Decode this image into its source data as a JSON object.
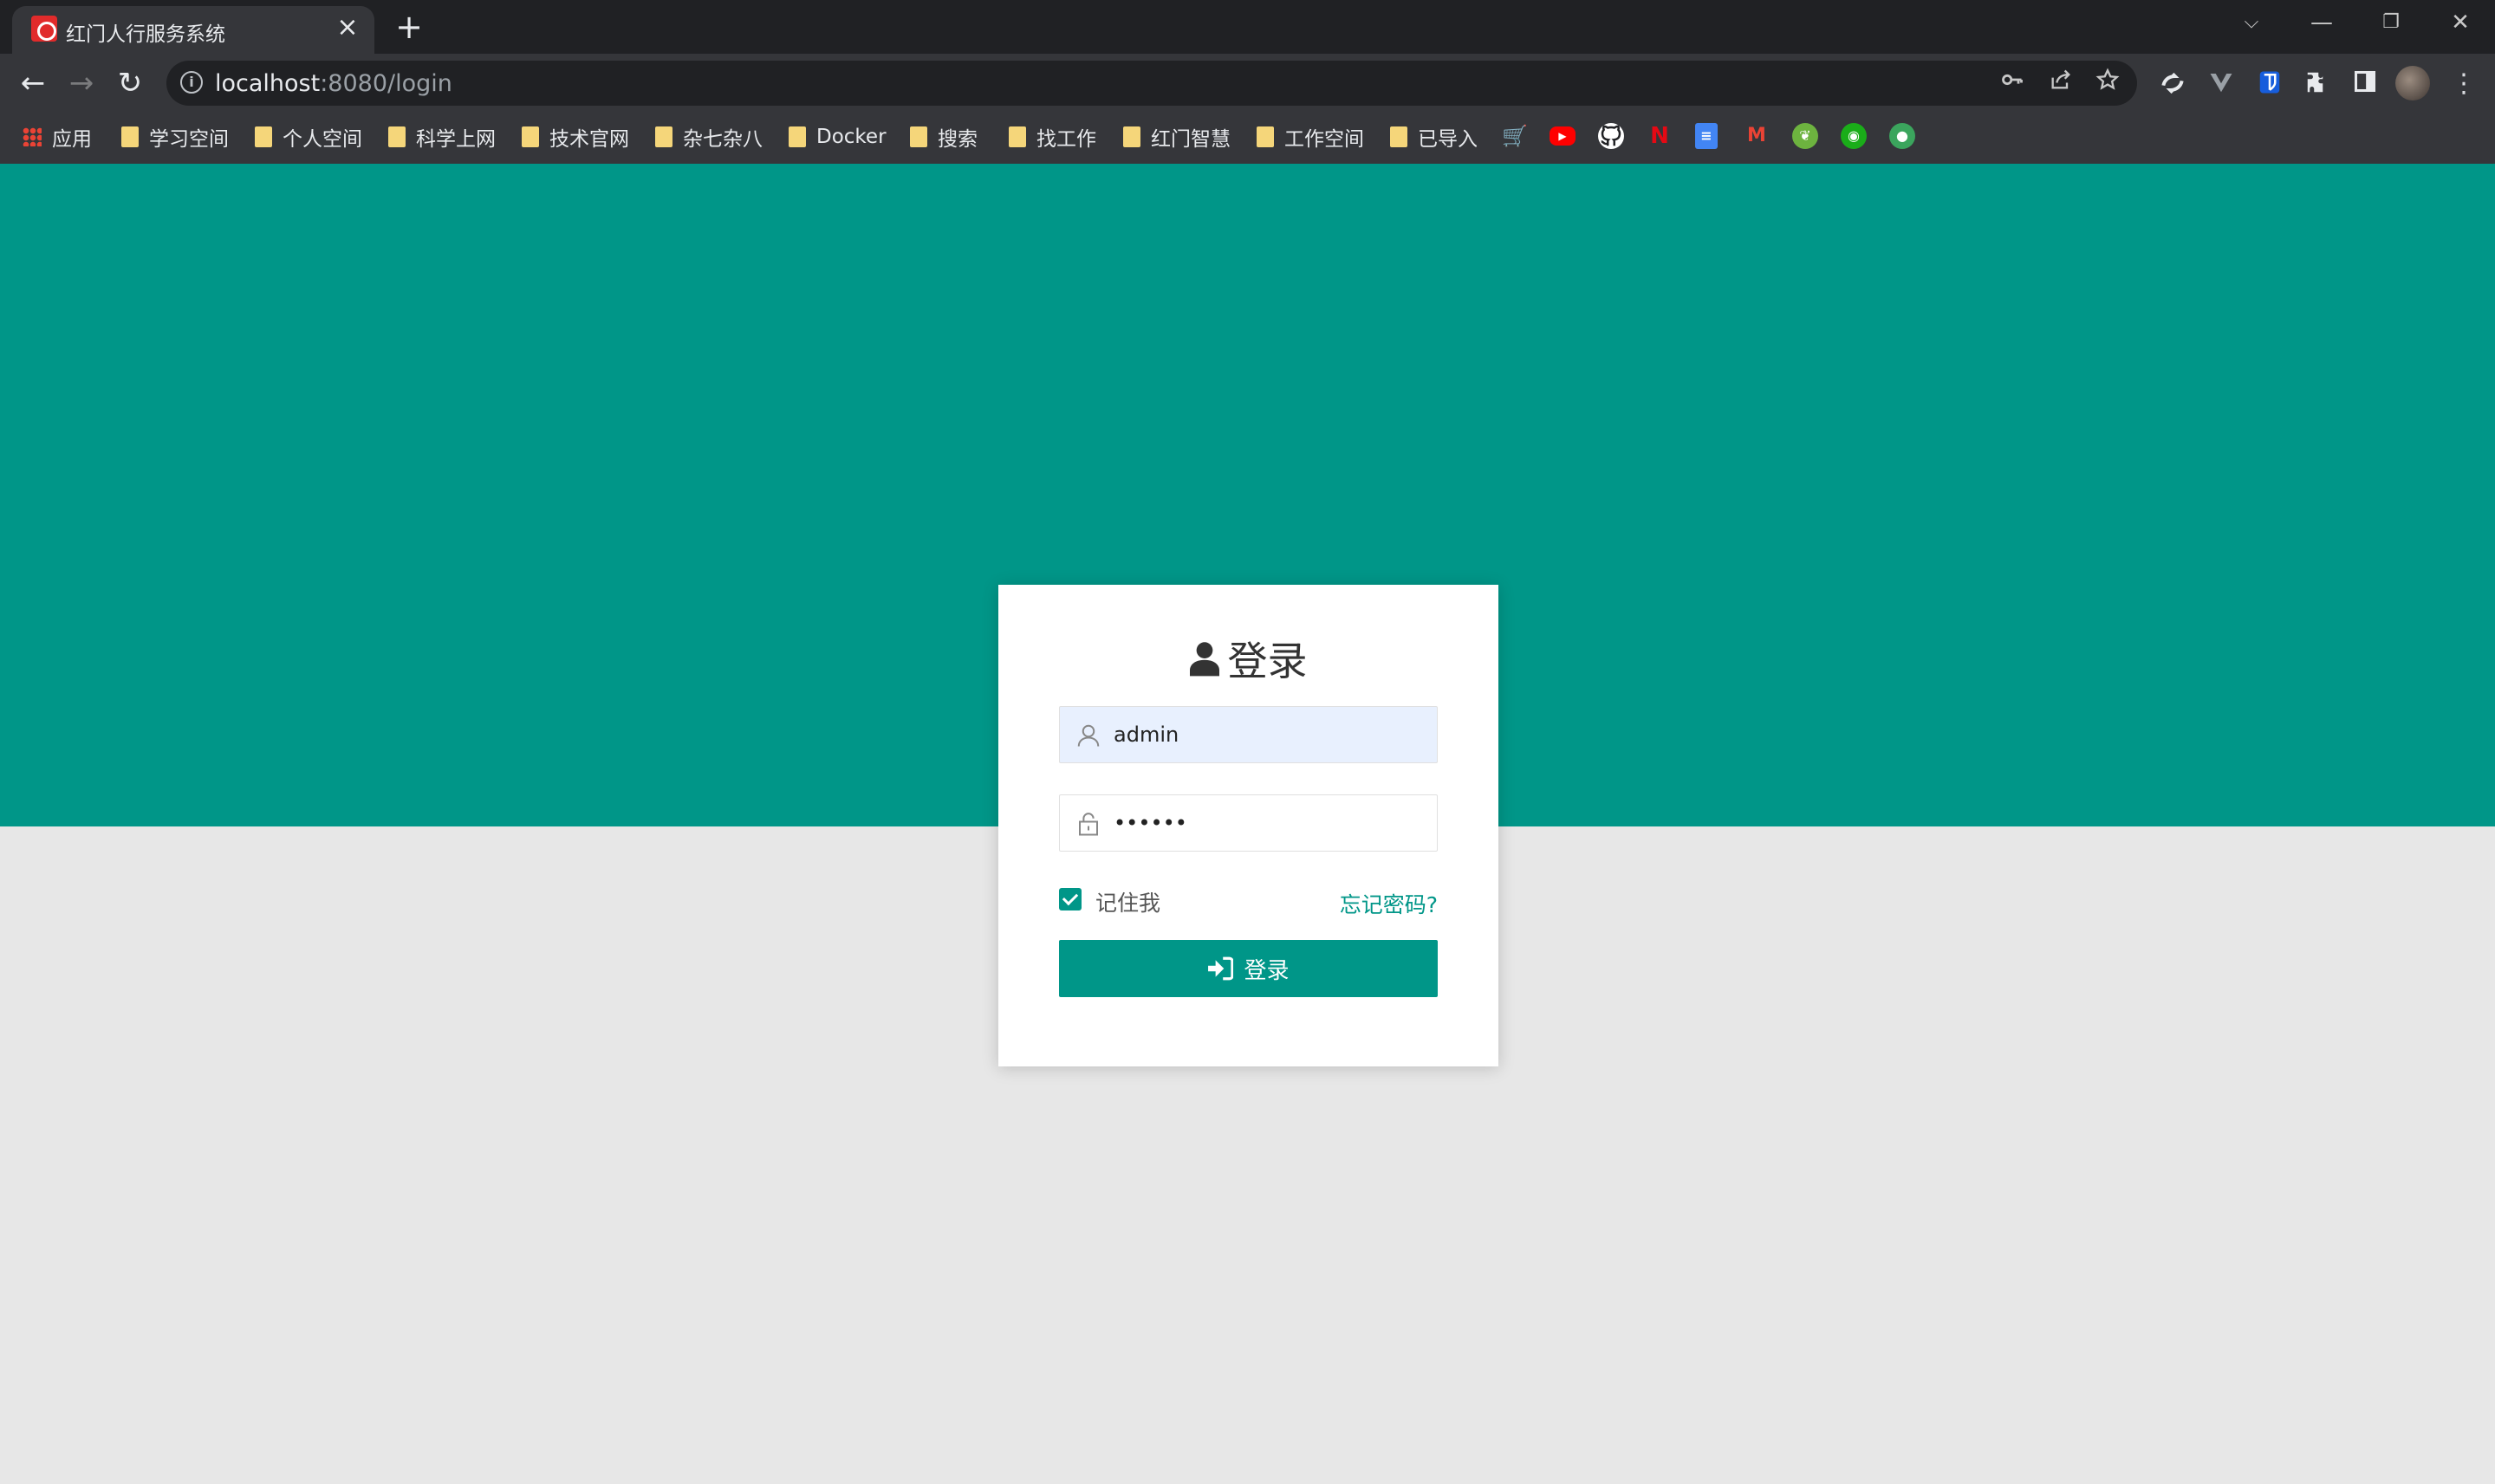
{
  "browser": {
    "tab": {
      "title": "红门人行服务系统",
      "close": "×"
    },
    "new_tab": "+",
    "window_controls": {
      "tab_search": "⌵",
      "minimize": "—",
      "restore": "❐",
      "close": "✕"
    },
    "nav": {
      "back": "←",
      "forward": "→",
      "reload": "↻"
    },
    "address": {
      "info": "i",
      "host": "localhost",
      "rest": ":8080/login"
    },
    "omnibox_icons": [
      "key-icon",
      "share-icon",
      "star-icon"
    ],
    "extension_icons": [
      "sync-icon",
      "vue-devtools-icon",
      "bitwarden-icon",
      "puzzle-icon",
      "side-panel-icon"
    ],
    "menu": "⋮",
    "bookmarks": [
      {
        "label": "应用",
        "type": "apps"
      },
      {
        "label": "学习空间",
        "type": "folder"
      },
      {
        "label": "个人空间",
        "type": "folder"
      },
      {
        "label": "科学上网",
        "type": "folder"
      },
      {
        "label": "技术官网",
        "type": "folder"
      },
      {
        "label": "杂七杂八",
        "type": "folder"
      },
      {
        "label": "Docker",
        "type": "folder"
      },
      {
        "label": "搜索",
        "type": "folder"
      },
      {
        "label": "找工作",
        "type": "folder"
      },
      {
        "label": "红门智慧",
        "type": "folder"
      },
      {
        "label": "工作空间",
        "type": "folder"
      },
      {
        "label": "已导入",
        "type": "folder"
      }
    ],
    "bookmark_icon_sites": [
      "cart-icon",
      "youtube-icon",
      "github-icon",
      "netflix-icon",
      "docs-icon",
      "gmail-icon",
      "leaf-icon",
      "wechat-icon",
      "green-app-icon"
    ],
    "colors": {
      "tabstrip": "#202124",
      "toolbar": "#35363a"
    }
  },
  "login": {
    "title": "登录",
    "username_value": "admin",
    "password_value": "••••••",
    "remember_label": "记住我",
    "remember_checked": true,
    "forgot_label": "忘记密码?",
    "submit_label": "登录"
  },
  "theme": {
    "accent": "#009688",
    "page_bg": "#e7e7e7",
    "card_bg": "#ffffff"
  }
}
